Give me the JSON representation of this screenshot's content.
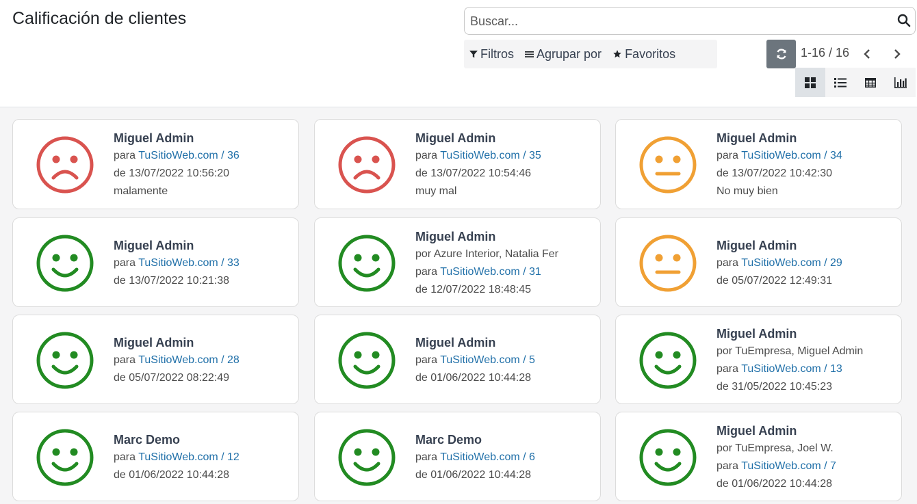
{
  "header": {
    "title": "Calificación de clientes",
    "search_placeholder": "Buscar...",
    "filters_label": "Filtros",
    "group_by_label": "Agrupar por",
    "favorites_label": "Favoritos",
    "pager_value": "1-16 / 16"
  },
  "colors": {
    "unhappy": "#d9534f",
    "neutral": "#f0a034",
    "happy": "#228b22",
    "link": "#1f6fa8"
  },
  "cards": [
    {
      "name": "Miguel Admin",
      "rating": "unhappy",
      "by": "",
      "para": "para",
      "link": "TuSitioWeb.com / 36",
      "date": "de 13/07/2022 10:56:20",
      "feedback": "malamente"
    },
    {
      "name": "Miguel Admin",
      "rating": "unhappy",
      "by": "",
      "para": "para",
      "link": "TuSitioWeb.com / 35",
      "date": "de 13/07/2022 10:54:46",
      "feedback": "muy mal"
    },
    {
      "name": "Miguel Admin",
      "rating": "neutral",
      "by": "",
      "para": "para",
      "link": "TuSitioWeb.com / 34",
      "date": "de 13/07/2022 10:42:30",
      "feedback": "No muy bien"
    },
    {
      "name": "Miguel Admin",
      "rating": "happy",
      "by": "",
      "para": "para",
      "link": "TuSitioWeb.com / 33",
      "date": "de 13/07/2022 10:21:38",
      "feedback": ""
    },
    {
      "name": "Miguel Admin",
      "rating": "happy",
      "by": "por Azure Interior, Natalia Fer",
      "para": "para",
      "link": "TuSitioWeb.com / 31",
      "date": "de 12/07/2022 18:48:45",
      "feedback": ""
    },
    {
      "name": "Miguel Admin",
      "rating": "neutral",
      "by": "",
      "para": "para",
      "link": "TuSitioWeb.com / 29",
      "date": "de 05/07/2022 12:49:31",
      "feedback": ""
    },
    {
      "name": "Miguel Admin",
      "rating": "happy",
      "by": "",
      "para": "para",
      "link": "TuSitioWeb.com / 28",
      "date": "de 05/07/2022 08:22:49",
      "feedback": ""
    },
    {
      "name": "Miguel Admin",
      "rating": "happy",
      "by": "",
      "para": "para",
      "link": "TuSitioWeb.com / 5",
      "date": "de 01/06/2022 10:44:28",
      "feedback": ""
    },
    {
      "name": "Miguel Admin",
      "rating": "happy",
      "by": "por TuEmpresa, Miguel Admin",
      "para": "para",
      "link": "TuSitioWeb.com / 13",
      "date": "de 31/05/2022 10:45:23",
      "feedback": ""
    },
    {
      "name": "Marc Demo",
      "rating": "happy",
      "by": "",
      "para": "para",
      "link": "TuSitioWeb.com / 12",
      "date": "de 01/06/2022 10:44:28",
      "feedback": ""
    },
    {
      "name": "Marc Demo",
      "rating": "happy",
      "by": "",
      "para": "para",
      "link": "TuSitioWeb.com / 6",
      "date": "de 01/06/2022 10:44:28",
      "feedback": ""
    },
    {
      "name": "Miguel Admin",
      "rating": "happy",
      "by": "por TuEmpresa, Joel W.",
      "para": "para",
      "link": "TuSitioWeb.com / 7",
      "date": "de 01/06/2022 10:44:28",
      "feedback": ""
    }
  ]
}
